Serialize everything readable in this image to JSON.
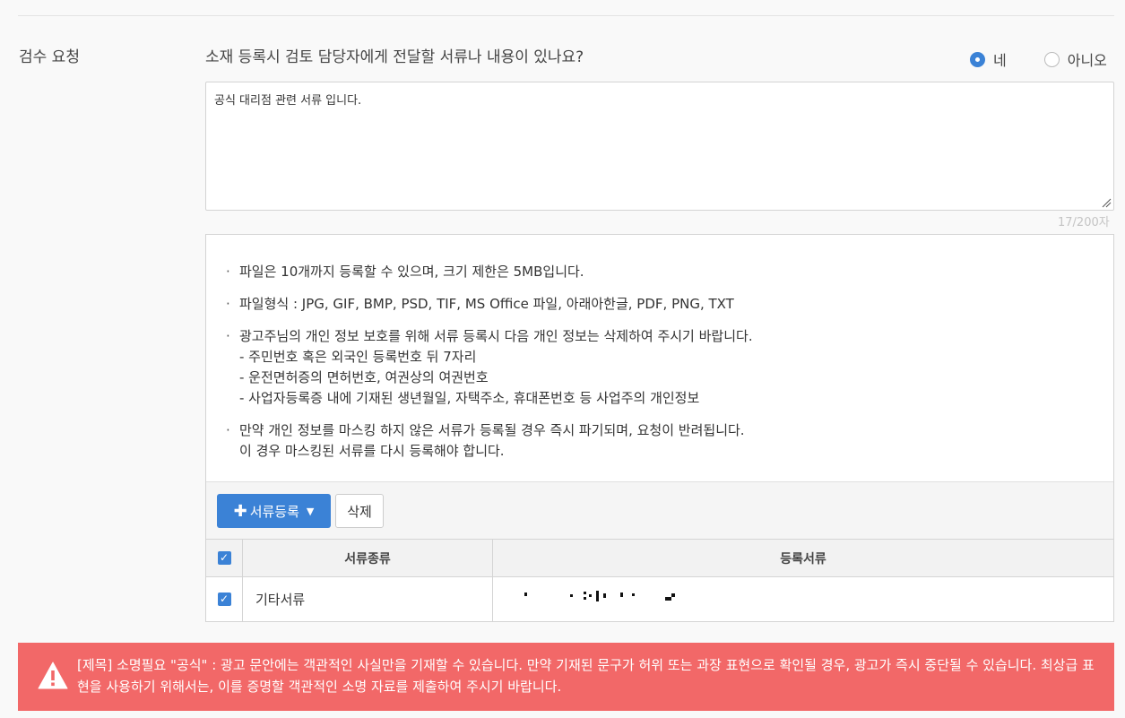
{
  "review": {
    "section_label": "검수 요청",
    "question": "소재 등록시 검토 담당자에게 전달할 서류나 내용이 있나요?",
    "radio_yes": "네",
    "radio_no": "아니오",
    "selected": "네",
    "textarea_value": "공식 대리점 관련 서류 입니다.",
    "char_count": "17/200자"
  },
  "notes": {
    "n1": "파일은 10개까지 등록할 수 있으며, 크기 제한은 5MB입니다.",
    "n2": "파일형식 : JPG, GIF, BMP, PSD, TIF, MS Office 파일, 아래아한글, PDF, PNG, TXT",
    "n3": "광고주님의 개인 정보 보호를 위해 서류 등록시 다음 개인 정보는 삭제하여 주시기 바랍니다.",
    "n3_sub1": "- 주민번호 혹은 외국인 등록번호 뒤 7자리",
    "n3_sub2": "- 운전면허증의 면허번호, 여권상의 여권번호",
    "n3_sub3": "- 사업자등록증 내에 기재된 생년월일, 자택주소, 휴대폰번호 등 사업주의 개인정보",
    "n4": "만약 개인 정보를 마스킹 하지 않은 서류가 등록될 경우 즉시 파기되며, 요청이 반려됩니다.",
    "n4_sub1": "이 경우 마스킹된 서류를 다시 등록해야 합니다."
  },
  "toolbar": {
    "register_label": "서류등록",
    "delete_label": "삭제"
  },
  "table": {
    "headers": [
      "서류종류",
      "등록서류"
    ],
    "rows": [
      {
        "type": "기타서류",
        "document": "",
        "checked": true
      }
    ],
    "header_checked": true
  },
  "alert": {
    "text": "[제목] 소명필요 \"공식\" : 광고 문안에는 객관적인 사실만을 기재할 수 있습니다. 만약 기재된 문구가 허위 또는 과장 표현으로 확인될 경우, 광고가 즉시 중단될 수 있습니다. 최상급 표현을 사용하기 위해서는, 이를 증명할 객관적인 소명 자료를 제출하여 주시기 바랍니다."
  },
  "colors": {
    "accent": "#3b82d6",
    "alert_bg": "#f26868"
  }
}
